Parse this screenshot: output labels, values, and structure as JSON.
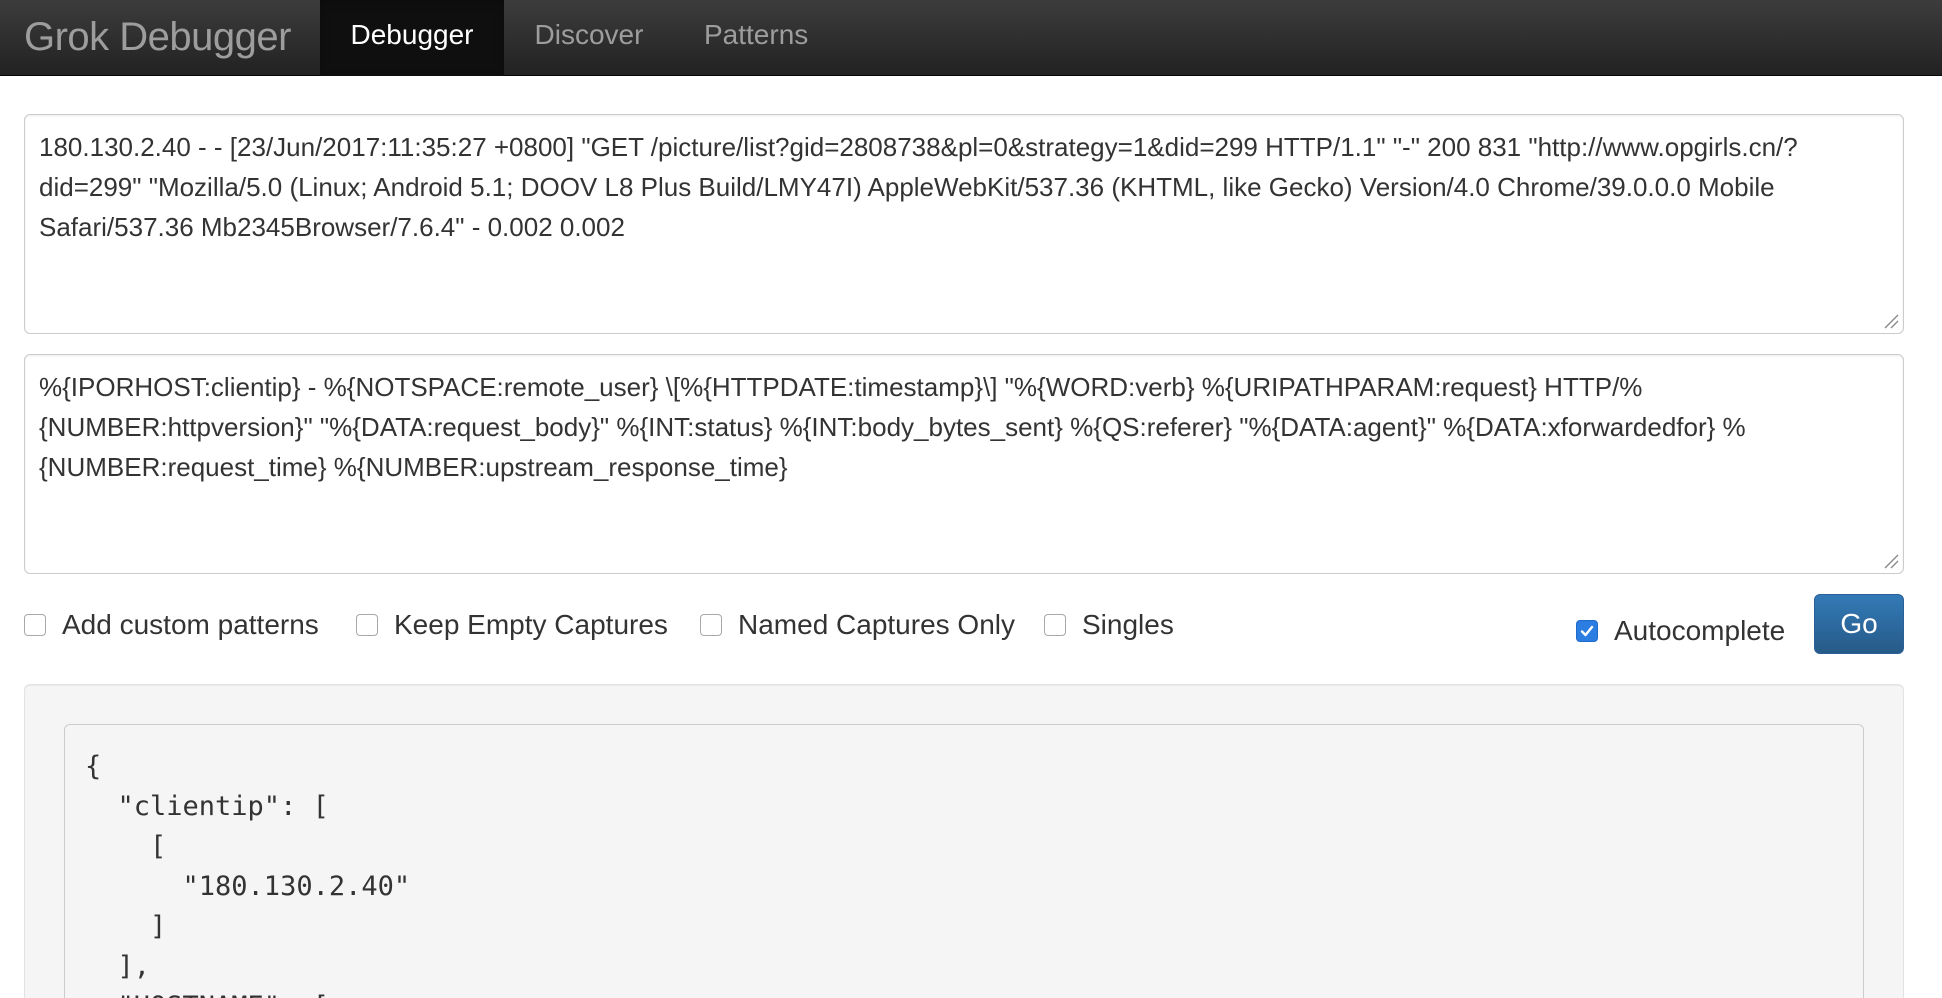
{
  "navbar": {
    "brand": "Grok Debugger",
    "tabs": [
      {
        "label": "Debugger",
        "active": true
      },
      {
        "label": "Discover",
        "active": false
      },
      {
        "label": "Patterns",
        "active": false
      }
    ]
  },
  "sample_input": {
    "value": "180.130.2.40 - - [23/Jun/2017:11:35:27 +0800] \"GET /picture/list?gid=2808738&pl=0&strategy=1&did=299 HTTP/1.1\" \"-\" 200 831 \"http://www.opgirls.cn/?did=299\" \"Mozilla/5.0 (Linux; Android 5.1; DOOV L8 Plus Build/LMY47I) AppleWebKit/537.36 (KHTML, like Gecko) Version/4.0 Chrome/39.0.0.0 Mobile Safari/537.36 Mb2345Browser/7.6.4\" - 0.002  0.002"
  },
  "pattern_input": {
    "value": "%{IPORHOST:clientip} - %{NOTSPACE:remote_user} \\[%{HTTPDATE:timestamp}\\] \"%{WORD:verb} %{URIPATHPARAM:request} HTTP/%{NUMBER:httpversion}\" \"%{DATA:request_body}\" %{INT:status} %{INT:body_bytes_sent} %{QS:referer} \"%{DATA:agent}\" %{DATA:xforwardedfor} %{NUMBER:request_time}  %{NUMBER:upstream_response_time}"
  },
  "options": {
    "add_custom_patterns": {
      "label": "Add custom patterns",
      "checked": false
    },
    "keep_empty_captures": {
      "label": "Keep Empty Captures",
      "checked": false
    },
    "named_captures_only": {
      "label": "Named Captures Only",
      "checked": false
    },
    "singles": {
      "label": "Singles",
      "checked": false
    },
    "autocomplete": {
      "label": "Autocomplete",
      "checked": true
    }
  },
  "go_button": {
    "label": "Go"
  },
  "result": {
    "lines": [
      "{",
      "  \"clientip\": [",
      "    [",
      "      \"180.130.2.40\"",
      "    ]",
      "  ],",
      "  \"HOSTNAME\": ["
    ]
  },
  "colors": {
    "navbar_bg": "#222222",
    "active_tab_bg": "#0f0f0f",
    "go_button": "#286090",
    "checkbox_checked": "#2b7de1",
    "spellcheck_squiggle": "#e0322b"
  }
}
